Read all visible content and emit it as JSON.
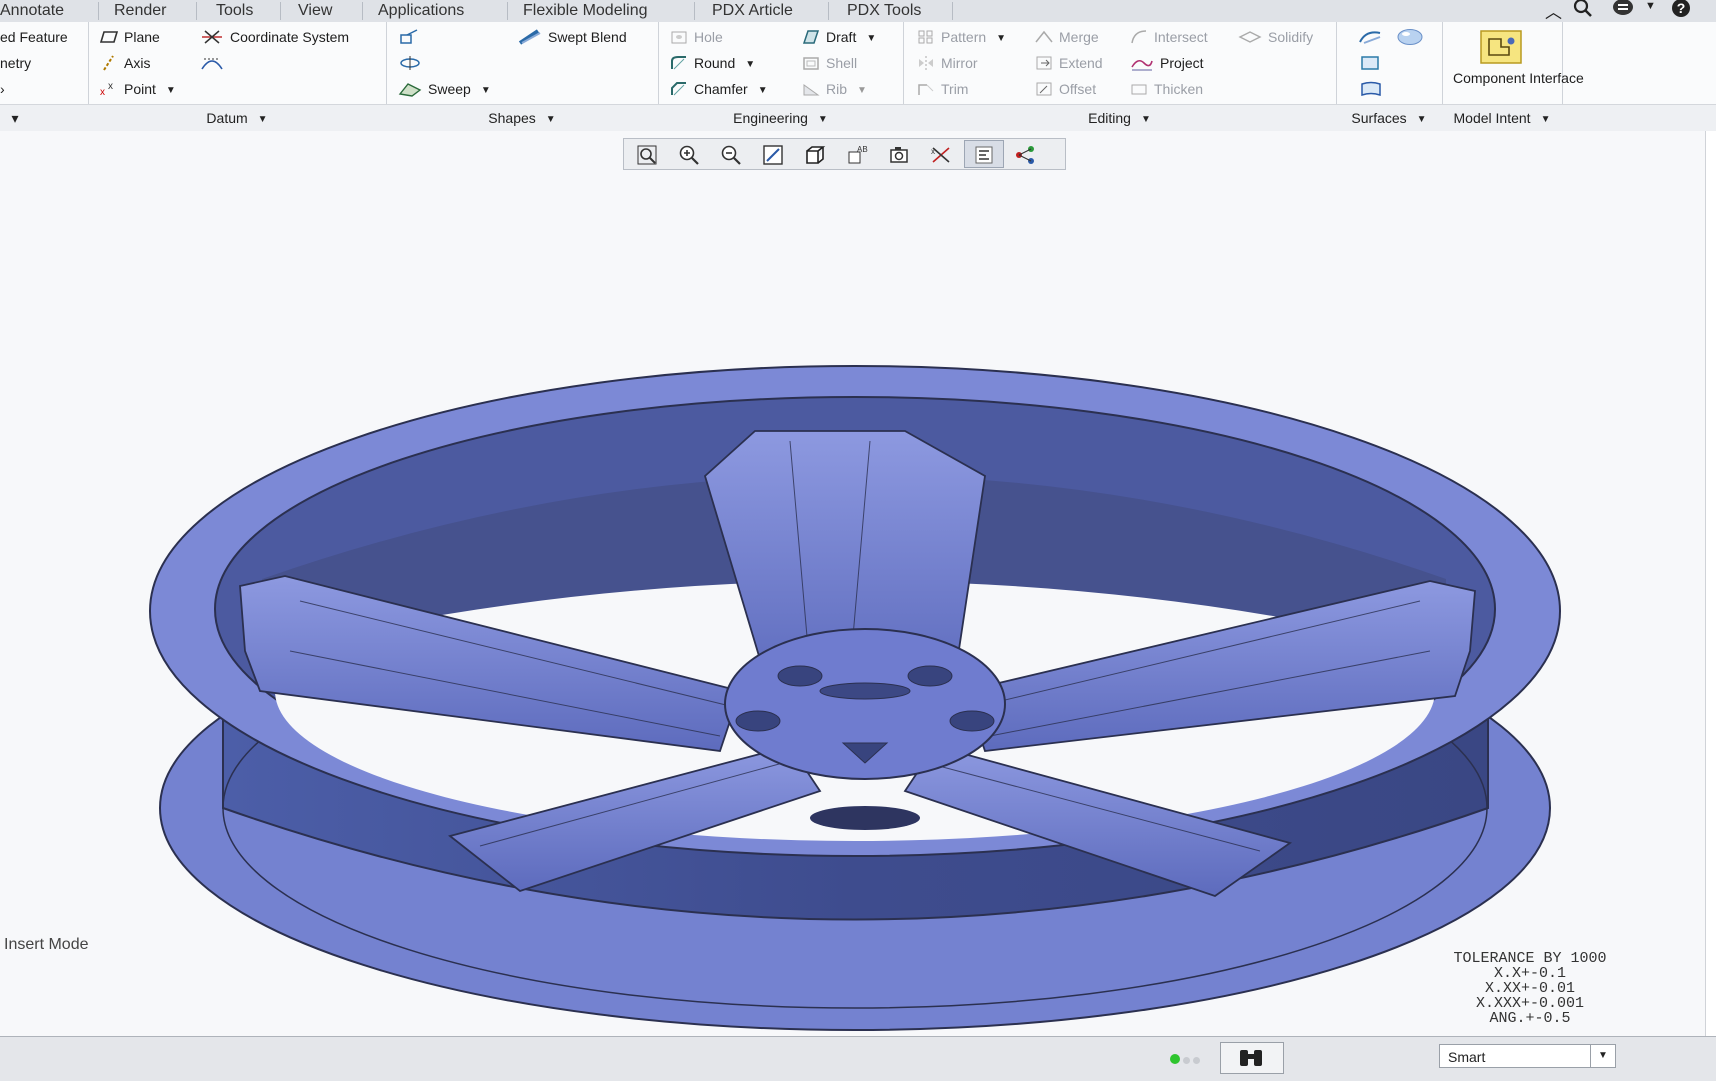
{
  "menubar": {
    "tabs": [
      "Annotate",
      "Render",
      "Tools",
      "View",
      "Applications",
      "Flexible Modeling",
      "PDX Article",
      "PDX Tools"
    ]
  },
  "ribbon": {
    "col0": [
      "ed Feature",
      "netry"
    ],
    "datum": {
      "plane": "Plane",
      "axis": "Axis",
      "point": "Point",
      "coord": "Coordinate System"
    },
    "shapes": {
      "swept_blend": "Swept Blend",
      "sweep": "Sweep"
    },
    "engineering": {
      "hole": "Hole",
      "round": "Round",
      "chamfer": "Chamfer",
      "draft": "Draft",
      "shell": "Shell",
      "rib": "Rib"
    },
    "editing": {
      "pattern": "Pattern",
      "mirror": "Mirror",
      "trim": "Trim",
      "merge": "Merge",
      "extend": "Extend",
      "offset": "Offset",
      "intersect": "Intersect",
      "project": "Project",
      "thicken": "Thicken",
      "solidify": "Solidify"
    },
    "model_intent": {
      "component_interface": "Component Interface"
    },
    "groups": {
      "datum": "Datum",
      "shapes": "Shapes",
      "engineering": "Engineering",
      "editing": "Editing",
      "surfaces": "Surfaces",
      "model_intent": "Model Intent"
    }
  },
  "viewport": {
    "mode_text": "Insert Mode",
    "tolerance": [
      "TOLERANCE BY 1000",
      "X.X+-0.1",
      "X.XX+-0.01",
      "X.XXX+-0.001",
      "ANG.+-0.5"
    ],
    "model_color": "#6f7ccf"
  },
  "statusbar": {
    "filter_value": "Smart"
  }
}
